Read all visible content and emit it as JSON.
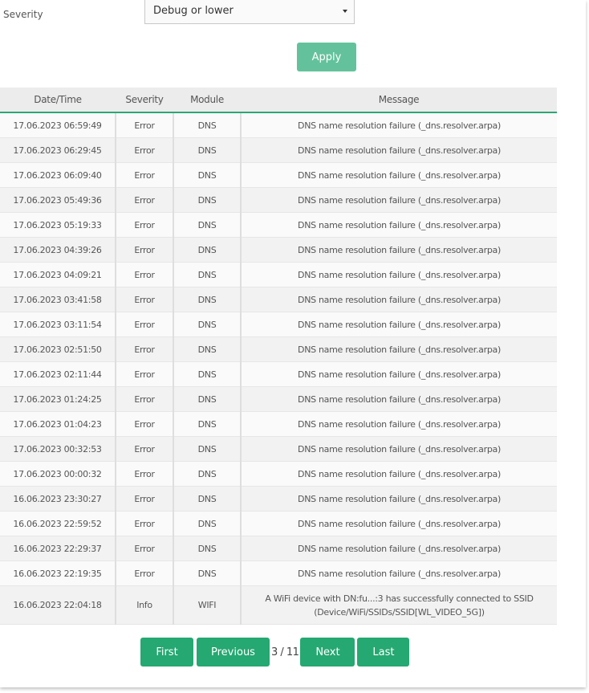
{
  "filter": {
    "severity_label": "Severity",
    "severity_value": "Debug or lower",
    "apply_label": "Apply"
  },
  "table": {
    "headers": [
      "Date/Time",
      "Severity",
      "Module",
      "Message"
    ],
    "rows": [
      {
        "datetime": "17.06.2023 06:59:49",
        "severity": "Error",
        "module": "DNS",
        "message": "DNS name resolution failure (_dns.resolver.arpa)"
      },
      {
        "datetime": "17.06.2023 06:29:45",
        "severity": "Error",
        "module": "DNS",
        "message": "DNS name resolution failure (_dns.resolver.arpa)"
      },
      {
        "datetime": "17.06.2023 06:09:40",
        "severity": "Error",
        "module": "DNS",
        "message": "DNS name resolution failure (_dns.resolver.arpa)"
      },
      {
        "datetime": "17.06.2023 05:49:36",
        "severity": "Error",
        "module": "DNS",
        "message": "DNS name resolution failure (_dns.resolver.arpa)"
      },
      {
        "datetime": "17.06.2023 05:19:33",
        "severity": "Error",
        "module": "DNS",
        "message": "DNS name resolution failure (_dns.resolver.arpa)"
      },
      {
        "datetime": "17.06.2023 04:39:26",
        "severity": "Error",
        "module": "DNS",
        "message": "DNS name resolution failure (_dns.resolver.arpa)"
      },
      {
        "datetime": "17.06.2023 04:09:21",
        "severity": "Error",
        "module": "DNS",
        "message": "DNS name resolution failure (_dns.resolver.arpa)"
      },
      {
        "datetime": "17.06.2023 03:41:58",
        "severity": "Error",
        "module": "DNS",
        "message": "DNS name resolution failure (_dns.resolver.arpa)"
      },
      {
        "datetime": "17.06.2023 03:11:54",
        "severity": "Error",
        "module": "DNS",
        "message": "DNS name resolution failure (_dns.resolver.arpa)"
      },
      {
        "datetime": "17.06.2023 02:51:50",
        "severity": "Error",
        "module": "DNS",
        "message": "DNS name resolution failure (_dns.resolver.arpa)"
      },
      {
        "datetime": "17.06.2023 02:11:44",
        "severity": "Error",
        "module": "DNS",
        "message": "DNS name resolution failure (_dns.resolver.arpa)"
      },
      {
        "datetime": "17.06.2023 01:24:25",
        "severity": "Error",
        "module": "DNS",
        "message": "DNS name resolution failure (_dns.resolver.arpa)"
      },
      {
        "datetime": "17.06.2023 01:04:23",
        "severity": "Error",
        "module": "DNS",
        "message": "DNS name resolution failure (_dns.resolver.arpa)"
      },
      {
        "datetime": "17.06.2023 00:32:53",
        "severity": "Error",
        "module": "DNS",
        "message": "DNS name resolution failure (_dns.resolver.arpa)"
      },
      {
        "datetime": "17.06.2023 00:00:32",
        "severity": "Error",
        "module": "DNS",
        "message": "DNS name resolution failure (_dns.resolver.arpa)"
      },
      {
        "datetime": "16.06.2023 23:30:27",
        "severity": "Error",
        "module": "DNS",
        "message": "DNS name resolution failure (_dns.resolver.arpa)"
      },
      {
        "datetime": "16.06.2023 22:59:52",
        "severity": "Error",
        "module": "DNS",
        "message": "DNS name resolution failure (_dns.resolver.arpa)"
      },
      {
        "datetime": "16.06.2023 22:29:37",
        "severity": "Error",
        "module": "DNS",
        "message": "DNS name resolution failure (_dns.resolver.arpa)"
      },
      {
        "datetime": "16.06.2023 22:19:35",
        "severity": "Error",
        "module": "DNS",
        "message": "DNS name resolution failure (_dns.resolver.arpa)"
      },
      {
        "datetime": "16.06.2023 22:04:18",
        "severity": "Info",
        "module": "WIFI",
        "message": "A WiFi device with DN:fu...:3 has successfully connected to SSID (Device/WiFi/SSIDs/SSID[WL_VIDEO_5G])"
      }
    ]
  },
  "pagination": {
    "first": "First",
    "previous": "Previous",
    "page_info": "3 / 11",
    "next": "Next",
    "last": "Last"
  }
}
